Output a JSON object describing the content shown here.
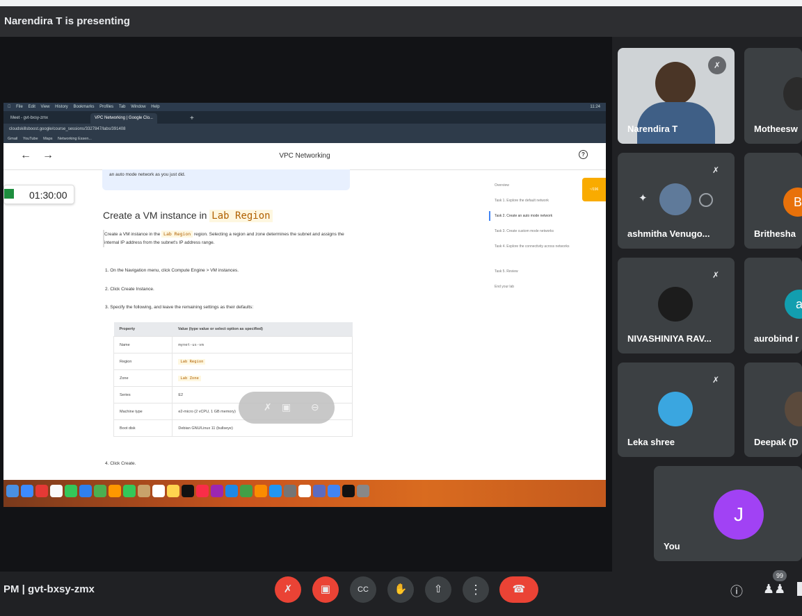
{
  "presenting_banner": "Narendira T is presenting",
  "shared_screen": {
    "menu_items": [
      "File",
      "Edit",
      "View",
      "History",
      "Bookmarks",
      "Profiles",
      "Tab",
      "Window",
      "Help"
    ],
    "clock": "11:24",
    "tabs": [
      "Meet - gvt-bxsy-zmx",
      "VPC Networking | Google Clo..."
    ],
    "address": "cloudskillsboost.google/course_sessions/3327847/labs/391408",
    "bookmarks": [
      "Gmail",
      "YouTube",
      "Maps",
      "Networking Essen..."
    ],
    "page_title": "VPC Networking",
    "callout_text": "an auto mode network as you just did.",
    "timer": "01:30:00",
    "heading_prefix": "Create a VM instance in",
    "heading_code": "Lab Region",
    "para_1": "Create a VM instance in the",
    "para_code": "Lab Region",
    "para_2": "region. Selecting a region and zone determines the subnet and assigns the internal IP address from the subnet's IP address range.",
    "step_1": "1. On the Navigation menu, click Compute Engine > VM instances.",
    "step_2": "2. Click Create Instance.",
    "step_3": "3. Specify the following, and leave the remaining settings as their defaults:",
    "step_4": "4. Click Create.",
    "table_headers": [
      "Property",
      "Value (type value or select option as specified)"
    ],
    "table_rows": [
      [
        "Name",
        "mynet-us-vm"
      ],
      [
        "Region",
        "Lab Region"
      ],
      [
        "Zone",
        "Lab Zone"
      ],
      [
        "Series",
        "E2"
      ],
      [
        "Machine type",
        "e2-micro (2 vCPU, 1 GB memory)"
      ],
      [
        "Boot disk",
        "Debian GNU/Linux 11 (bullseye)"
      ]
    ],
    "toc": [
      "Overview",
      "Task 1. Explore the default network",
      "Task 2. Create an auto mode network",
      "Task 3. Create custom mode networks",
      "Task 4. Explore the connectivity across networks",
      "Task 5. Review",
      "End your lab"
    ],
    "orange_tab": "~/196"
  },
  "participants": [
    {
      "name": "Narendira T"
    },
    {
      "name": "Motheesw"
    },
    {
      "name": "ashmitha Venugo..."
    },
    {
      "name": "Brithesha",
      "initial": "B",
      "color": "#e8710a"
    },
    {
      "name": "NIVASHINIYA RAV..."
    },
    {
      "name": "aurobind r",
      "initial": "a",
      "color": "#129eaf"
    },
    {
      "name": "Leka shree"
    },
    {
      "name": "Deepak (D"
    },
    {
      "name": "You",
      "initial": "J",
      "color": "#a142f4"
    }
  ],
  "bottom_bar": {
    "time_meeting": "PM  |  gvt-bxsy-zmx",
    "people_count": "99"
  }
}
